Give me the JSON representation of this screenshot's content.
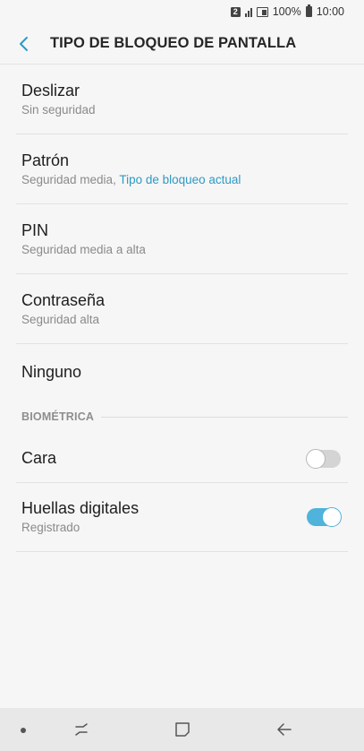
{
  "status_bar": {
    "sim_label": "2",
    "battery_percent": "100%",
    "time": "10:00"
  },
  "header": {
    "title": "TIPO DE BLOQUEO DE PANTALLA",
    "back_icon": "chevron-left-icon"
  },
  "lock_types": [
    {
      "title": "Deslizar",
      "subtitle": "Sin seguridad"
    },
    {
      "title": "Patrón",
      "subtitle": "Seguridad media, ",
      "subtitle_accent": "Tipo de bloqueo actual"
    },
    {
      "title": "PIN",
      "subtitle": "Seguridad media a alta"
    },
    {
      "title": "Contraseña",
      "subtitle": "Seguridad alta"
    },
    {
      "title": "Ninguno"
    }
  ],
  "biometrics": {
    "section_label": "BIOMÉTRICA",
    "items": [
      {
        "title": "Cara",
        "toggle": false
      },
      {
        "title": "Huellas digitales",
        "subtitle": "Registrado",
        "toggle": true
      }
    ]
  },
  "colors": {
    "accent": "#2d9ac4",
    "toggle_on": "#4fb3db",
    "background": "#f6f6f6"
  },
  "navbar": {
    "icons": [
      "dot-icon",
      "recent-apps-icon",
      "home-icon",
      "back-arrow-icon"
    ]
  }
}
